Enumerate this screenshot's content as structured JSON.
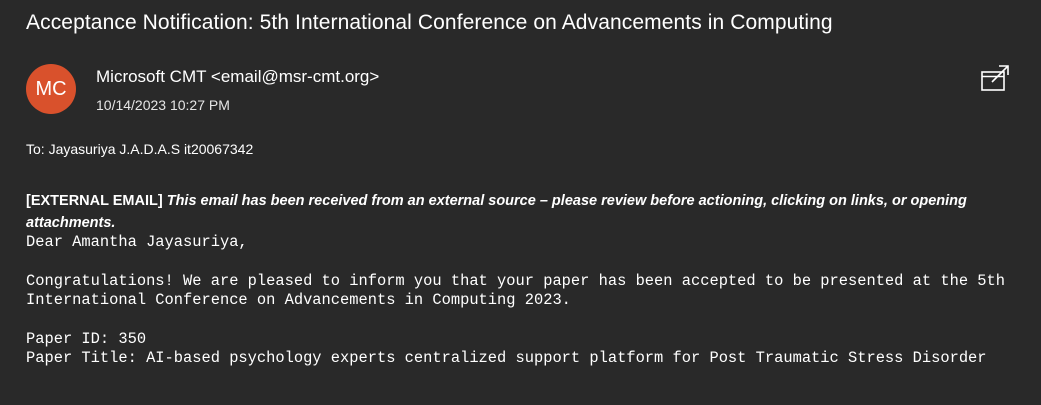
{
  "email": {
    "subject": "Acceptance Notification: 5th International Conference on Advancements in Computing",
    "avatar_initials": "MC",
    "avatar_color": "#d9512c",
    "sender": "Microsoft CMT <email@msr-cmt.org>",
    "datetime": "10/14/2023 10:27 PM",
    "to_line": "To:  Jayasuriya J.A.D.A.S it20067342",
    "popout_icon": "open-in-new-window-icon"
  },
  "body": {
    "external_tag": "[EXTERNAL EMAIL]",
    "external_text": " This email has been received from an external source – please review before actioning, clicking on links, or opening attachments.",
    "greeting": "Dear Amantha Jayasuriya,",
    "paragraph": "Congratulations! We are pleased to inform you that your paper has been accepted to be presented at the 5th International Conference on Advancements in Computing 2023.",
    "paper_id": "Paper ID: 350",
    "paper_title": "Paper Title: AI-based psychology experts centralized support platform for Post Traumatic Stress Disorder"
  }
}
